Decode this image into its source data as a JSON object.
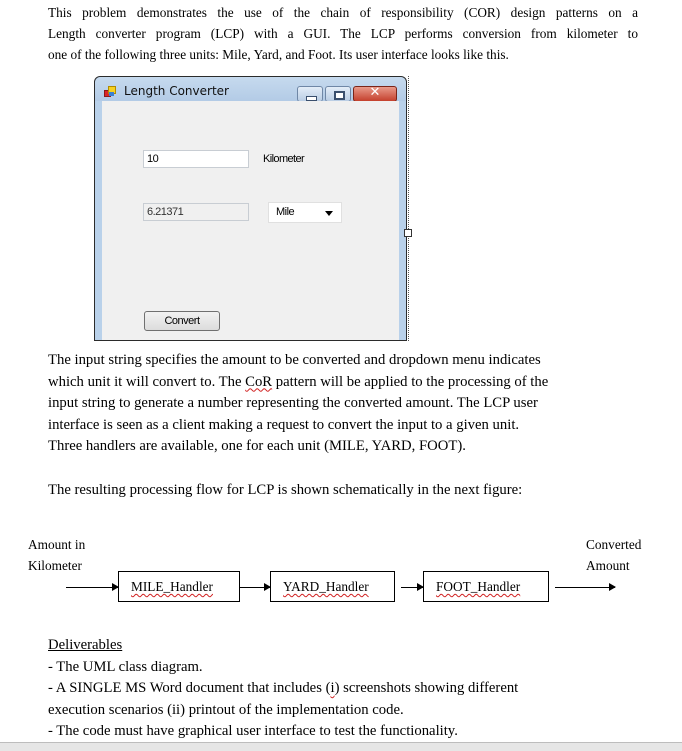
{
  "intro": {
    "lines": [
      "This problem demonstrates the use of the chain of responsibility (COR) design patterns on a",
      "Length converter program (LCP) with a GUI. The LCP performs conversion from kilometer to",
      "one of the following three units: Mile, Yard, and Foot. Its user interface looks like this."
    ]
  },
  "window": {
    "title": "Length Converter",
    "close_glyph": "✕",
    "input_value": "10",
    "input_unit_label": "Kilometer",
    "output_value": "6.21371",
    "unit_select_value": "Mile",
    "convert_button": "Convert"
  },
  "description": {
    "lines": [
      "The input string specifies the amount to be converted and dropdown menu indicates",
      [
        "which unit it will convert to. The ",
        "CoR",
        " pattern will be applied to the processing of the"
      ],
      "input string to generate a number representing the converted amount. The LCP user",
      "interface is seen as a client making a request to convert the input to a given unit.",
      "Three handlers are available, one for each unit (MILE, YARD, FOOT)."
    ],
    "flow_intro": "The resulting processing flow for LCP is shown schematically in the next figure:"
  },
  "flow": {
    "input_label": [
      "Amount  in",
      "Kilometer"
    ],
    "output_label": [
      "Converted",
      "Amount"
    ],
    "handlers": [
      "MILE_Handler",
      "YARD_Handler",
      "FOOT_Handler"
    ]
  },
  "deliverables": {
    "heading": "Deliverables",
    "item1": "- The UML class diagram.",
    "item2_pre": "- A SINGLE MS Word document that includes (",
    "item2_sq": "i",
    "item2_post": ") screenshots showing different",
    "item2_cont": "execution scenarios (ii) printout of the implementation code.",
    "item3": "- The code must have graphical user interface to test the functionality."
  }
}
